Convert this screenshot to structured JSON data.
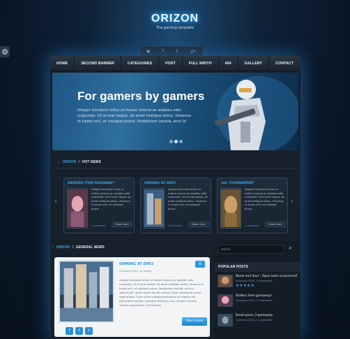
{
  "logo": {
    "title": "ORIZON",
    "subtitle": "The gaming template"
  },
  "social": [
    "rss-icon",
    "facebook-icon",
    "twitter-icon",
    "googleplus-icon"
  ],
  "nav": [
    "HOME",
    "SECOND BANNER",
    "CATEGORIES",
    "POST",
    "FULL WIDTH",
    "404",
    "GALLERY",
    "CONTACT"
  ],
  "hero": {
    "title": "For gamers by gamers",
    "text": "Integer tincidunt tellus ut metus viverra ac sodales odio vulputate. Ut id erat neque, sit amet tristique tellus. Vivamus in turpis orci, et volutpat purus. Vestibulum lacinia, arcu id",
    "slides": 3,
    "active_slide": 1
  },
  "hot_news": {
    "brand": "ORIZON",
    "sep": "//",
    "title": "HOT NEWS",
    "cards": [
      {
        "title": "RAIDERZ ITEM GIVEAWAY!",
        "text": "Integer tincidunt tellus ut metus viverra ac sodales odio vulputate. Ut id erat neque, sit amet tristique tellus. Vivamus in turpis orci, et volutpat purus.",
        "comments": "1 comment",
        "button": "Read more"
      },
      {
        "title": "OWNING AT DAY2",
        "text": "Integer tincidunt tellus ut metus viverra ac sodales odio vulputate. Ut id erat neque, sit amet tristique tellus. Vivamus in turpis orci, et volutpat purus.",
        "comments": "0 comment",
        "button": "Read more"
      },
      {
        "title": "LOL TOURNAMENT",
        "text": "Integer tincidunt tellus ut metus viverra ac sodales odio vulputate. Ut id erat neque, sit amet tristique tellus. Vivamus in turpis orci, et volutpat purus.",
        "comments": "1 comment",
        "button": "Read more"
      }
    ]
  },
  "general_news": {
    "brand": "ORIZON",
    "sep": "//",
    "title": "GENERAL NEWS",
    "post": {
      "title": "OWNING AT DAY2",
      "badge": "0",
      "meta": "4 January 2013, by admin",
      "text": "Integer tincidunt tellus ut metus viverra ac sodales odio vulputate. Ut id erat neque, sit amet tristique tellus. Vivamus in turpis orci, et volutpat purus. Vestibulum lacinia, arcu id sollicitudin, lorem lorem iaculis massa, vitae consequat tortor eget massa. Cum sociis natoque penatibus et magnis dis parturient montes, nascetur ridiculus mus. Nullam ultrices viverra consectetur. Sed lacinia",
      "more": "Read more",
      "share": [
        "f",
        "t",
        "+"
      ]
    }
  },
  "sidebar": {
    "search_placeholder": "search",
    "popular_title": "POPULAR POSTS",
    "posts": [
      {
        "title": "Blade and Soul – Open beta announced!",
        "meta": "4 January 2013, 3 Comments",
        "stars": "★★★★★"
      },
      {
        "title": "Raiderz item giveaway!",
        "meta": "3 January 2013, 1 Comments",
        "stars": ""
      },
      {
        "title": "Dead space 3 gameplay",
        "meta": "3 January 2013, 1 Comments",
        "stars": ""
      }
    ]
  },
  "colors": {
    "accent": "#3aa4e8",
    "glow": "#2e8ce1",
    "background": "#0e2238"
  }
}
